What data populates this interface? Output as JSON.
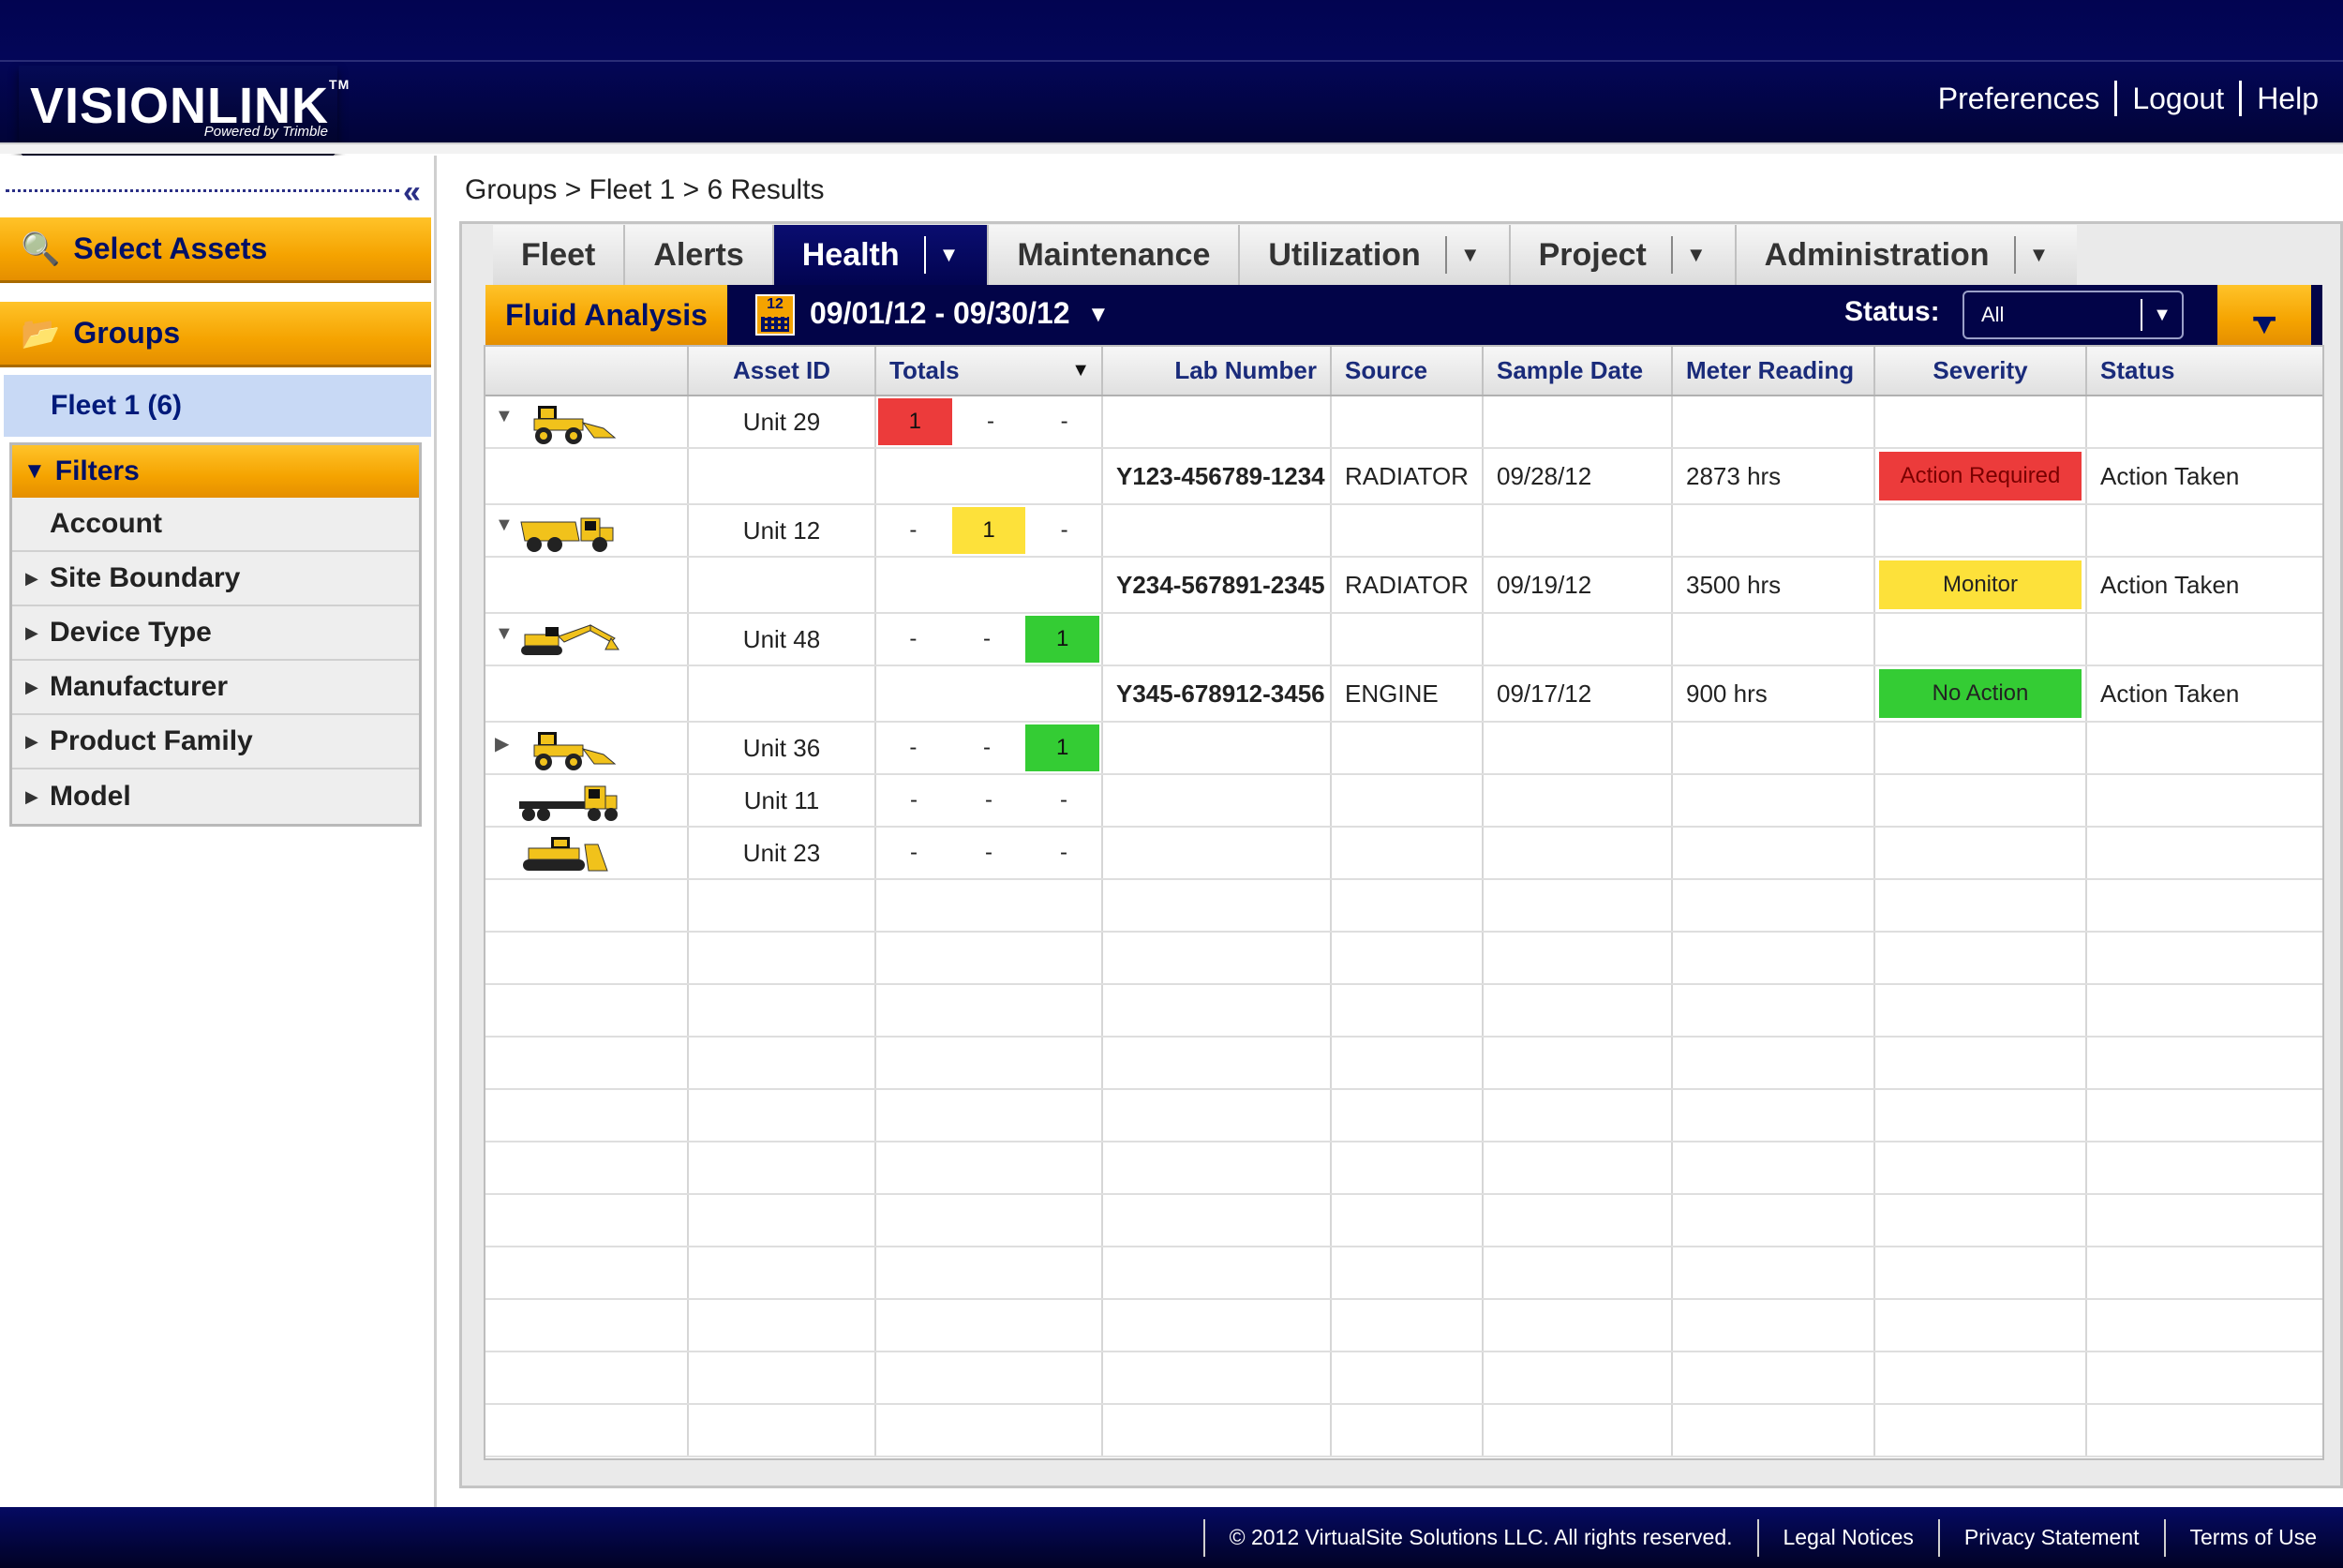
{
  "header": {
    "logo_text": "VISIONLINK",
    "logo_tm": "TM",
    "logo_sub": "Powered by Trimble",
    "links": [
      "Preferences",
      "Logout",
      "Help"
    ]
  },
  "sidebar": {
    "select_assets": "Select Assets",
    "groups": "Groups",
    "fleet_item": "Fleet 1 (6)",
    "filters_title": "Filters",
    "filters": [
      "Account",
      "Site Boundary",
      "Device Type",
      "Manufacturer",
      "Product Family",
      "Model"
    ]
  },
  "breadcrumb": "Groups > Fleet 1  > 6 Results",
  "tabs": [
    {
      "label": "Fleet"
    },
    {
      "label": "Alerts"
    },
    {
      "label": "Health"
    },
    {
      "label": "Maintenance"
    },
    {
      "label": "Utilization"
    },
    {
      "label": "Project"
    },
    {
      "label": "Administration"
    }
  ],
  "subbar": {
    "fluid_analysis": "Fluid Analysis",
    "calendar_day": "12",
    "date_range": "09/01/12 - 09/30/12",
    "status_label": "Status:",
    "status_value": "All"
  },
  "table": {
    "headers": {
      "asset_id": "Asset ID",
      "totals": "Totals",
      "lab_number": "Lab Number",
      "source": "Source",
      "sample_date": "Sample Date",
      "meter_reading": "Meter Reading",
      "severity": "Severity",
      "status": "Status"
    },
    "units": [
      {
        "id": "Unit 29",
        "totals": [
          "1",
          "-",
          "-"
        ]
      },
      {
        "id": "Unit 12",
        "totals": [
          "-",
          "1",
          "-"
        ]
      },
      {
        "id": "Unit 48",
        "totals": [
          "-",
          "-",
          "1"
        ]
      },
      {
        "id": "Unit 36",
        "totals": [
          "-",
          "-",
          "1"
        ]
      },
      {
        "id": "Unit 11",
        "totals": [
          "-",
          "-",
          "-"
        ]
      },
      {
        "id": "Unit 23",
        "totals": [
          "-",
          "-",
          "-"
        ]
      }
    ],
    "details": [
      {
        "lab": "Y123-456789-1234",
        "source": "RADIATOR",
        "date": "09/28/12",
        "meter": "2873 hrs",
        "severity": "Action Required",
        "status": "Action Taken"
      },
      {
        "lab": "Y234-567891-2345",
        "source": "RADIATOR",
        "date": "09/19/12",
        "meter": "3500 hrs",
        "severity": "Monitor",
        "status": "Action Taken"
      },
      {
        "lab": "Y345-678912-3456",
        "source": "ENGINE",
        "date": "09/17/12",
        "meter": "900 hrs",
        "severity": "No Action",
        "status": "Action Taken"
      }
    ]
  },
  "footer": {
    "copyright": "© 2012 VirtualSite Solutions LLC. All rights reserved.",
    "links": [
      "Legal Notices",
      "Privacy Statement",
      "Terms of Use"
    ]
  },
  "colors": {
    "navy": "#020448",
    "orange": "#f5a300",
    "severity_red": "#ec3b3b",
    "severity_yellow": "#fde13a",
    "severity_green": "#34cc34"
  }
}
